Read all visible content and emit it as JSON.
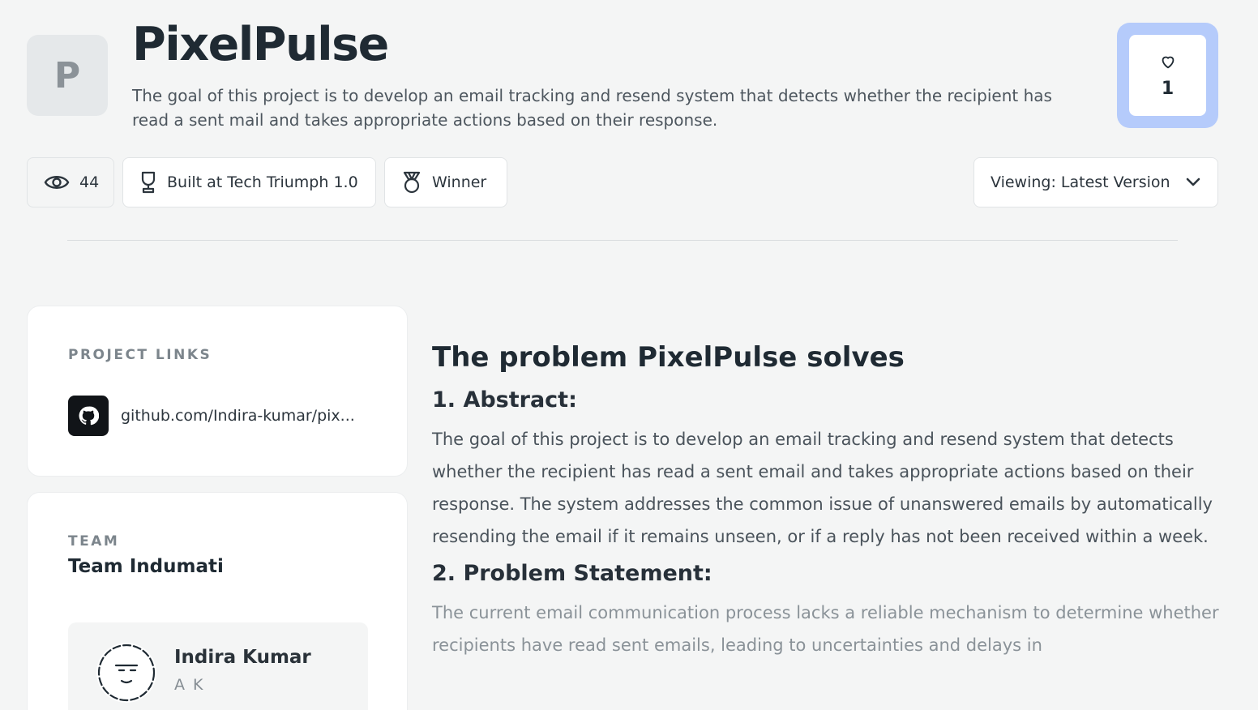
{
  "project": {
    "logo_letter": "P",
    "title": "PixelPulse",
    "description": "The goal of this project is to develop an email tracking and resend system that detects whether the recipient has read a sent mail and takes appropriate actions based on their response."
  },
  "likes": {
    "icon": "heart-icon",
    "count": "1"
  },
  "chips": {
    "views": {
      "icon": "eye-icon",
      "count": "44"
    },
    "built_at": {
      "icon": "trophy-icon",
      "label": "Built at Tech Triumph 1.0"
    },
    "prize": {
      "icon": "medal-icon",
      "label": "Winner"
    },
    "version": {
      "label": "Viewing: Latest Version",
      "icon": "chevron-down-icon"
    }
  },
  "links_card": {
    "heading": "PROJECT LINKS",
    "github": {
      "icon": "github-icon",
      "text": "github.com/Indira-kumar/pix..."
    }
  },
  "team_card": {
    "heading": "TEAM",
    "team_name": "Team Indumati",
    "members": [
      {
        "name": "Indira Kumar",
        "handle": "A K",
        "avatar_icon": "avatar-face-icon"
      }
    ]
  },
  "content": {
    "heading": "The problem PixelPulse solves",
    "sections": [
      {
        "title": "1. Abstract:",
        "body": "The goal of this project is to develop an email tracking and resend system that detects whether the recipient has read a sent email and takes appropriate actions based on their response. The system addresses the common issue of unanswered emails by automatically resending the email if it remains unseen, or if a reply has not been received within a week."
      },
      {
        "title": "2. Problem Statement:",
        "body": "The current email communication process lacks a reliable mechanism to determine whether recipients have read sent emails, leading to uncertainties and delays in"
      }
    ]
  },
  "colors": {
    "page_bg": "#f4f5f5",
    "like_accent": "#b5cbfb",
    "text_dark": "#1f2a33",
    "github_badge": "#111418"
  }
}
